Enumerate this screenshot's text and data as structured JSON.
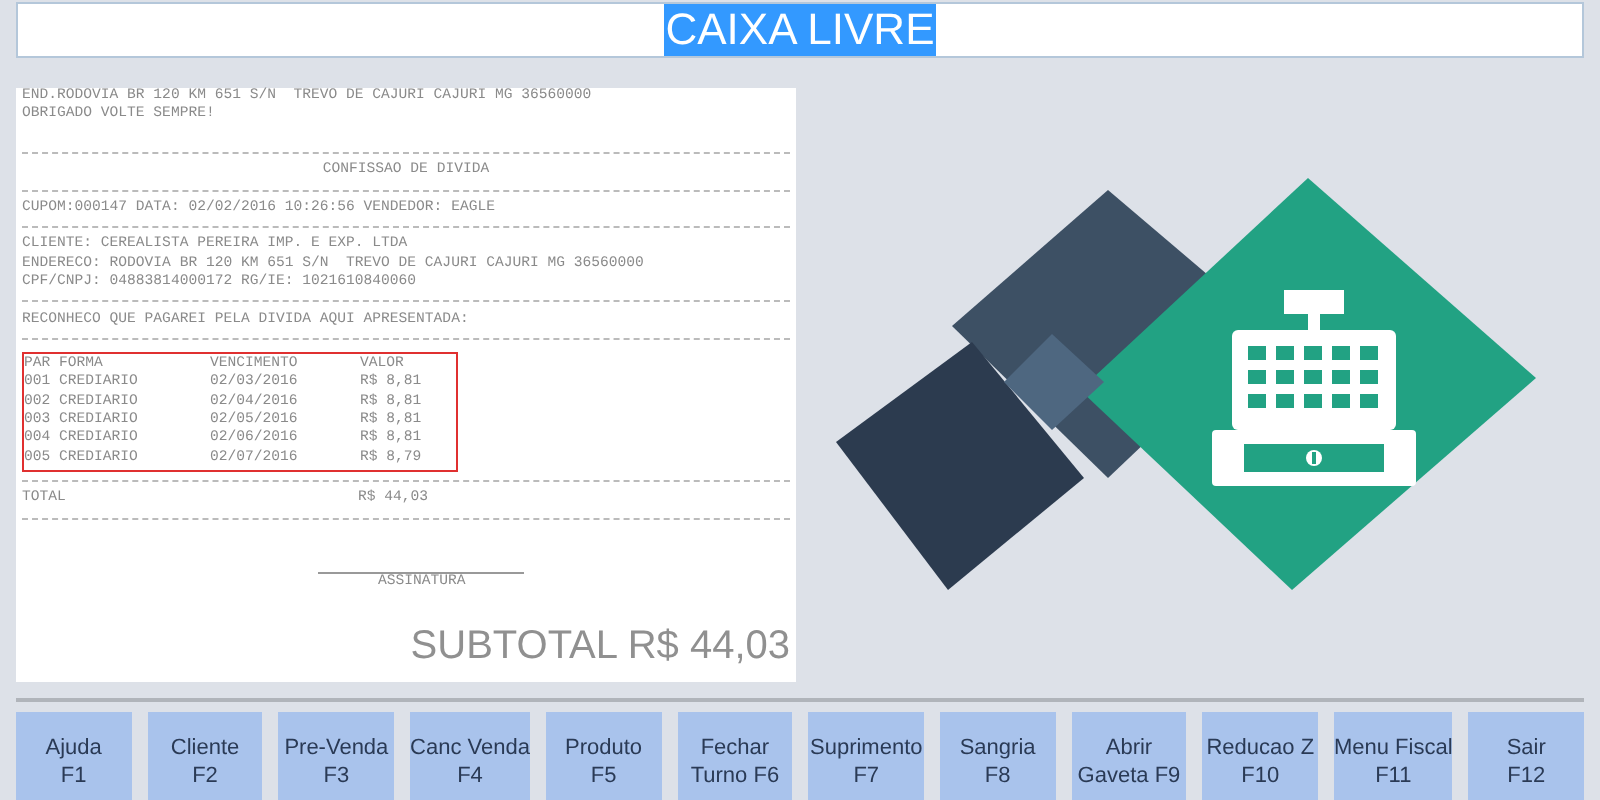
{
  "status_field": {
    "value": "CAIXA LIVRE",
    "selected": true
  },
  "receipt": {
    "lines_top": [
      {
        "kind": "text",
        "text": "END.RODOVIA BR 120 KM 651 S/N  TREVO DE CAJURI CAJURI MG 36560000"
      },
      {
        "kind": "text",
        "text": "OBRIGADO VOLTE SEMPRE!"
      },
      {
        "kind": "blank"
      },
      {
        "kind": "rule"
      },
      {
        "kind": "center",
        "text": "CONFISSAO DE DIVIDA"
      },
      {
        "kind": "rule"
      },
      {
        "kind": "text",
        "text": "CUPOM:000147 DATA: 02/02/2016 10:26:56 VENDEDOR: EAGLE"
      },
      {
        "kind": "rule"
      },
      {
        "kind": "text",
        "text": "CLIENTE: CEREALISTA PEREIRA IMP. E EXP. LTDA"
      },
      {
        "kind": "text",
        "text": "ENDERECO: RODOVIA BR 120 KM 651 S/N  TREVO DE CAJURI CAJURI MG 36560000"
      },
      {
        "kind": "text",
        "text": "CPF/CNPJ: 04883814000172 RG/IE: 1021610840060"
      },
      {
        "kind": "rule"
      },
      {
        "kind": "text",
        "text": "RECONHECO QUE PAGAREI PELA DIVIDA AQUI APRESENTADA:"
      },
      {
        "kind": "rule"
      }
    ],
    "installments": {
      "columns": [
        "PAR FORMA",
        "VENCIMENTO",
        "VALOR"
      ],
      "rows": [
        [
          "001 CREDIARIO",
          "02/03/2016",
          "R$ 8,81"
        ],
        [
          "002 CREDIARIO",
          "02/04/2016",
          "R$ 8,81"
        ],
        [
          "003 CREDIARIO",
          "02/05/2016",
          "R$ 8,81"
        ],
        [
          "004 CREDIARIO",
          "02/06/2016",
          "R$ 8,81"
        ],
        [
          "005 CREDIARIO",
          "02/07/2016",
          "R$ 8,79"
        ]
      ]
    },
    "total": {
      "label": "TOTAL",
      "value": "R$ 44,03"
    },
    "signature_label": "ASSINATURA",
    "subtotal": "SUBTOTAL R$ 44,03"
  },
  "function_keys": [
    {
      "label": "Ajuda",
      "key": "F1"
    },
    {
      "label": "Cliente",
      "key": "F2"
    },
    {
      "label": "Pre-Venda",
      "key": "F3"
    },
    {
      "label": "Canc Venda",
      "key": "F4"
    },
    {
      "label": "Produto",
      "key": "F5"
    },
    {
      "label": "Fechar",
      "key": "Turno F6"
    },
    {
      "label": "Suprimento",
      "key": "F7"
    },
    {
      "label": "Sangria",
      "key": "F8"
    },
    {
      "label": "Abrir",
      "key": "Gaveta F9"
    },
    {
      "label": "Reducao Z",
      "key": "F10"
    },
    {
      "label": "Menu Fiscal",
      "key": "F11"
    },
    {
      "label": "Sair",
      "key": "F12"
    }
  ]
}
